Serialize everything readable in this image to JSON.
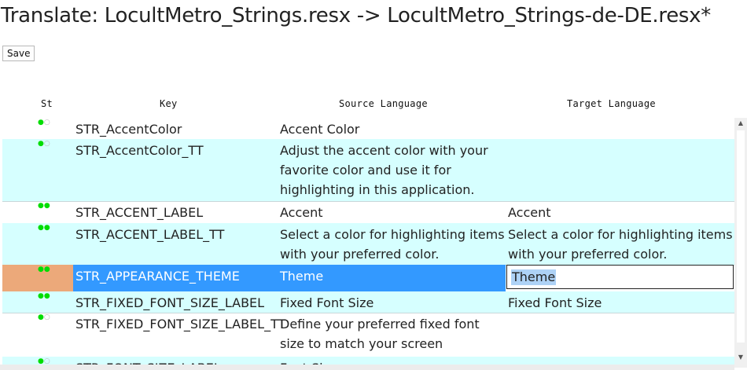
{
  "page": {
    "title": "Translate: LocultMetro_Strings.resx -> LocultMetro_Strings-de-DE.resx*",
    "save_label": "Save"
  },
  "columns": {
    "status": "St",
    "key": "Key",
    "source": "Source Language",
    "target": "Target Language"
  },
  "rows": [
    {
      "status": [
        "on",
        "off"
      ],
      "key": "STR_AccentColor",
      "source": "Accent Color",
      "target": "",
      "alt": false,
      "selected": false
    },
    {
      "status": [
        "on",
        "off"
      ],
      "key": "STR_AccentColor_TT",
      "source": "Adjust the accent color with your favorite color and use it for highlighting in this application.",
      "target": "",
      "alt": true,
      "selected": false
    },
    {
      "status": [
        "on",
        "on"
      ],
      "key": "STR_ACCENT_LABEL",
      "source": "Accent",
      "target": "Accent",
      "alt": false,
      "selected": false
    },
    {
      "status": [
        "on",
        "on"
      ],
      "key": "STR_ACCENT_LABEL_TT",
      "source": "Select a color for highlighting items with your preferred color.",
      "target": "Select a color for highlighting items with your preferred color.",
      "alt": true,
      "selected": false
    },
    {
      "status": [
        "on",
        "on"
      ],
      "key": "STR_APPEARANCE_THEME",
      "source": "Theme",
      "target": "Theme",
      "alt": false,
      "selected": true
    },
    {
      "status": [
        "on",
        "on"
      ],
      "key": "STR_FIXED_FONT_SIZE_LABEL",
      "source": "Fixed Font Size",
      "target": "Fixed Font Size",
      "alt": true,
      "selected": false
    },
    {
      "status": [
        "on",
        "off"
      ],
      "key": "STR_FIXED_FONT_SIZE_LABEL_TT",
      "source": "Define your preferred fixed font size to match your screen resolution.",
      "target": "",
      "alt": false,
      "selected": false
    },
    {
      "status": [
        "on",
        "off"
      ],
      "key": "STR_FONT_SIZE_LABEL",
      "source": "Font Size",
      "target": "",
      "alt": true,
      "selected": false
    }
  ],
  "colors": {
    "row_alt": "#d6ffff",
    "selection": "#3399ff",
    "selected_status": "#eca97a",
    "status_done": "#00dd00",
    "status_missing": "#b8b8b8"
  }
}
